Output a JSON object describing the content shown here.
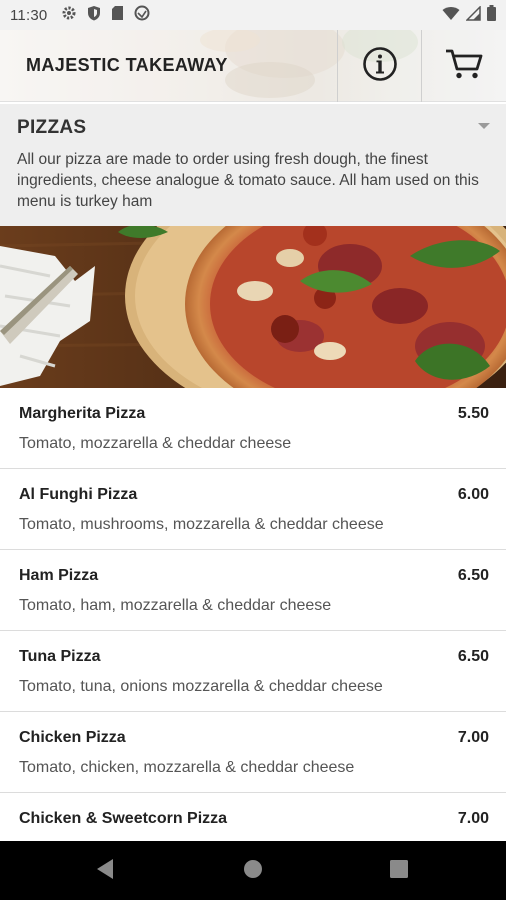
{
  "status_bar": {
    "time": "11:30",
    "icons": [
      "gear-icon",
      "shield-icon",
      "sd-card-icon",
      "no-disturb-icon",
      "wifi-icon",
      "signal-icon",
      "battery-icon"
    ]
  },
  "header": {
    "title": "MAJESTIC TAKEAWAY",
    "actions": [
      "info-icon",
      "cart-icon"
    ]
  },
  "category": {
    "title": "PIZZAS",
    "description": "All our pizza are made to order using fresh dough, the finest ingredients, cheese analogue & tomato sauce. All ham used on this menu is turkey ham",
    "expanded_indicator": "caret-down-icon"
  },
  "items": [
    {
      "name": "Margherita Pizza",
      "price": "5.50",
      "description": "Tomato, mozzarella & cheddar cheese"
    },
    {
      "name": "Al Funghi Pizza",
      "price": "6.00",
      "description": "Tomato, mushrooms, mozzarella & cheddar cheese"
    },
    {
      "name": "Ham Pizza",
      "price": "6.50",
      "description": "Tomato, ham, mozzarella & cheddar cheese"
    },
    {
      "name": "Tuna Pizza",
      "price": "6.50",
      "description": "Tomato, tuna, onions mozzarella & cheddar cheese"
    },
    {
      "name": "Chicken Pizza",
      "price": "7.00",
      "description": "Tomato, chicken, mozzarella & cheddar cheese"
    },
    {
      "name": "Chicken & Sweetcorn Pizza",
      "price": "7.00",
      "description": ""
    }
  ],
  "nav_bar": {
    "buttons": [
      "back-icon",
      "home-icon",
      "recents-icon"
    ]
  },
  "colors": {
    "status_bar_bg": "#f2f2f2",
    "category_bg": "#eeeeee",
    "nav_bar_bg": "#000000",
    "text_primary": "#222222",
    "text_secondary": "#555555"
  }
}
